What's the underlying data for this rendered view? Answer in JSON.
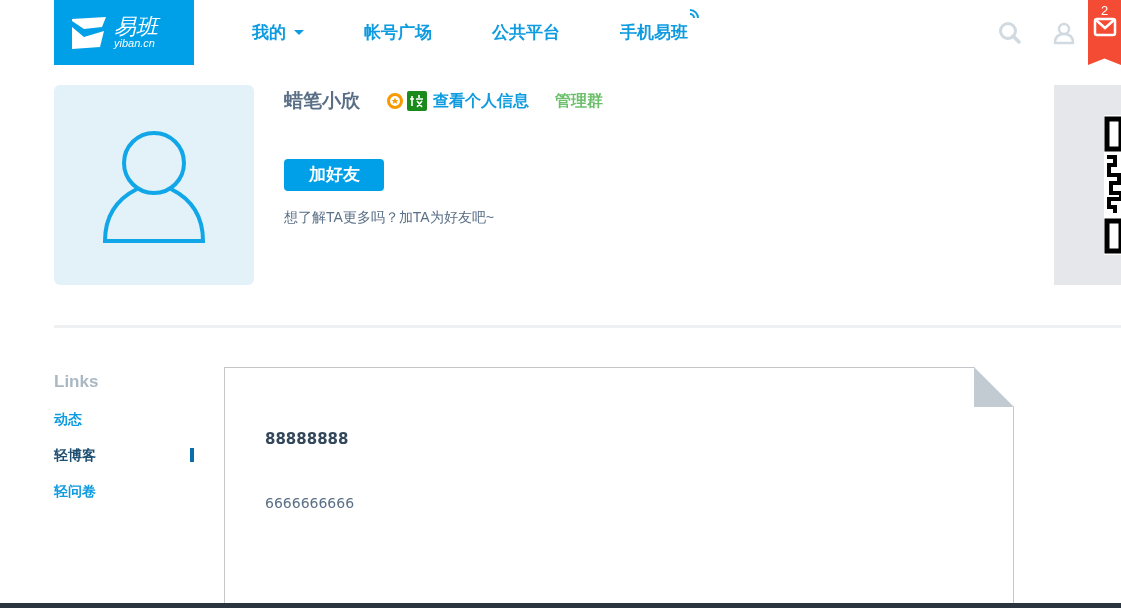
{
  "header": {
    "logo": {
      "name": "易班",
      "domain": "yiban.cn"
    },
    "nav": [
      {
        "label": "我的",
        "kind": "dropdown"
      },
      {
        "label": "帐号广场",
        "kind": "plain"
      },
      {
        "label": "公共平台",
        "kind": "plain"
      },
      {
        "label": "手机易班",
        "kind": "mobile"
      }
    ],
    "mail_badge": "2"
  },
  "profile": {
    "name": "蜡笔小欣",
    "info_link": "查看个人信息",
    "group_link": "管理群",
    "add_button": "加好友",
    "hint": "想了解TA更多吗？加TA为好友吧~"
  },
  "sidebar": {
    "title": "Links",
    "items": [
      {
        "label": "动态",
        "selected": false
      },
      {
        "label": "轻博客",
        "selected": true
      },
      {
        "label": "轻问卷",
        "selected": false
      }
    ]
  },
  "post": {
    "title": "88888888",
    "body": "6666666666"
  }
}
